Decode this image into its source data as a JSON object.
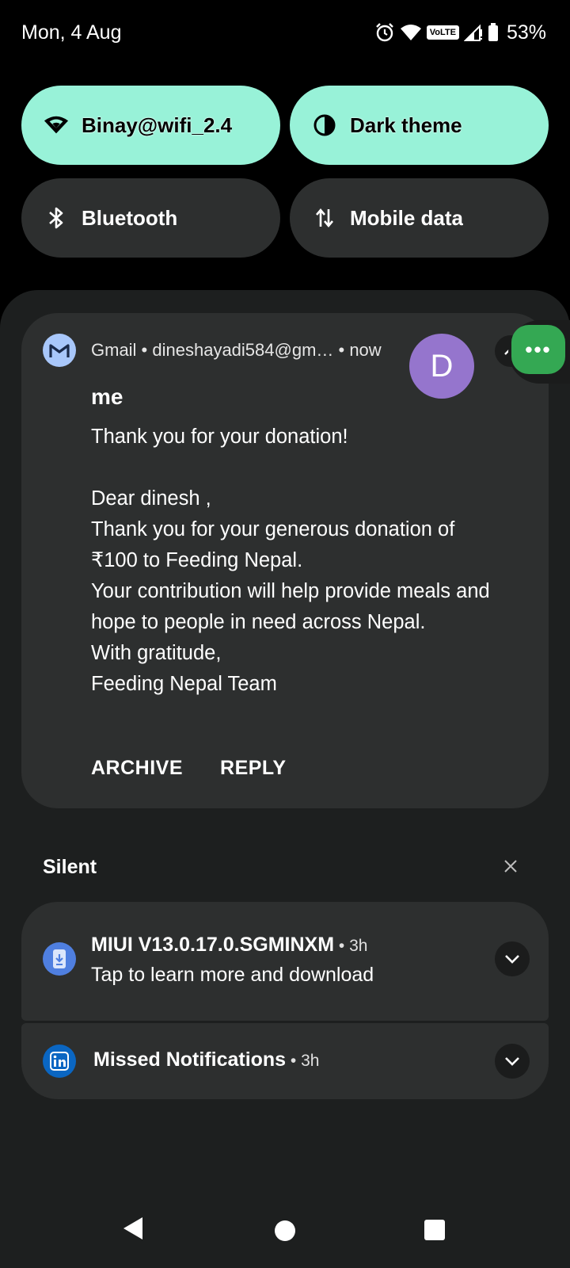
{
  "status_bar": {
    "date": "Mon, 4 Aug",
    "volte": "VoLTE",
    "battery_percent": "53%",
    "icons": [
      "alarm-icon",
      "wifi-icon",
      "volte-icon",
      "cell-signal-icon",
      "battery-icon"
    ]
  },
  "quick_tiles": [
    {
      "label": "Binay@wifi_2.4",
      "icon": "wifi-icon",
      "state": "on"
    },
    {
      "label": "Dark theme",
      "icon": "dark-theme-icon",
      "state": "on"
    },
    {
      "label": "Bluetooth",
      "icon": "bluetooth-icon",
      "state": "off"
    },
    {
      "label": "Mobile data",
      "icon": "mobile-data-icon",
      "state": "off"
    }
  ],
  "gmail_notification": {
    "app": "Gmail",
    "account": "dineshayadi584@gm…",
    "time": "now",
    "header": "Gmail • dineshayadi584@gm… • now",
    "avatar_letter": "D",
    "avatar_color": "#9575cd",
    "sender": "me",
    "subject": "Thank you for your donation!",
    "body_lines": [
      "Dear dinesh ,",
      "Thank you for your generous donation of",
      "₹100 to Feeding Nepal.",
      "Your contribution will help provide meals and",
      "hope to people in need across Nepal.",
      "With gratitude,",
      "Feeding Nepal Team"
    ],
    "actions": [
      "ARCHIVE",
      "REPLY"
    ]
  },
  "bubble": {
    "glyph": "•••",
    "color": "#34a853"
  },
  "silent_section": {
    "label": "Silent",
    "notifications": [
      {
        "title": "MIUI V13.0.17.0.SGMINXM",
        "time": " • 3h",
        "text": "Tap to learn more and download",
        "icon": "system-update-icon"
      },
      {
        "title": "Missed Notifications",
        "time": " • 3h",
        "icon": "linkedin-icon"
      }
    ]
  },
  "colors": {
    "tile_active": "#98f2d8",
    "tile_inactive": "#2d2f2f",
    "card": "#2d2f2f",
    "shade": "#1d1f1f"
  }
}
